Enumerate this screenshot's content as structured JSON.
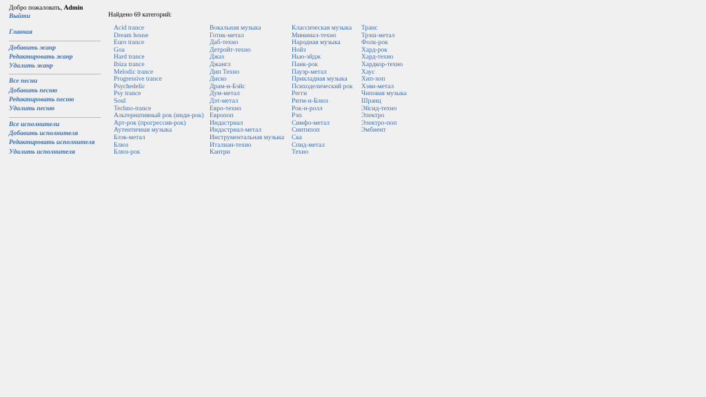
{
  "sidebar": {
    "welcome_text": "Добро пожаловать,",
    "username": "Admin",
    "logout": "Выйти",
    "home": "Главная",
    "genres": [
      "Добавить жанр",
      "Редактировать жанр",
      "Удалить жанр"
    ],
    "songs": [
      "Все песни",
      "Добавить песню",
      "Редактировать песню",
      "Удалить песню"
    ],
    "artists": [
      "Все исполнители",
      "Добавить исполнителя",
      "Редактировать исполнителя",
      "Удалить исполнителя"
    ]
  },
  "main": {
    "found_text": "Найдено 69 категорий:",
    "columns": [
      [
        "Acid trance",
        "Dream house",
        "Euro trance",
        "Goa",
        "Hard trance",
        "Ibiza trance",
        "Melodic trance",
        "Progressive trance",
        "Psychedelic",
        "Psy trance",
        "Soul",
        "Techno-trance",
        "Альтернативный рок (инди-рок)",
        "Арт-рок (прогрессив-рок)",
        "Аутентичная музыка",
        "Блэк-метал",
        "Блюз",
        "Блюз-рок"
      ],
      [
        "Вокальная музыка",
        "Готик-метал",
        "Даб-техно",
        "Детройт-техно",
        "Джаз",
        "Джангл",
        "Дип Техно",
        "Диско",
        "Драм-н-Бэйс",
        "Дум-метал",
        "Дэт-метал",
        "Евро-техно",
        "Европоп",
        "Индастриал",
        "Индастриал-метал",
        "Инструментальная музыка",
        "Италиан-техно",
        "Кантри"
      ],
      [
        "Классическая музыка",
        "Минимал-техно",
        "Народная музыка",
        "Нойз",
        "Нью-эйдж",
        "Панк-рок",
        "Пауэр-метал",
        "Прикладная музыка",
        "Психоделический рок",
        "Регги",
        "Ритм-н-Блюз",
        "Рок-н-ролл",
        "Рэп",
        "Симфо-метал",
        "Синтипоп",
        "Ска",
        "Спид-метал",
        "Техно"
      ],
      [
        "Транс",
        "Трэш-метал",
        "Фолк-рок",
        "Хард-рок",
        "Хард-техно",
        "Хардкор-техно",
        "Хаус",
        "Хип-хоп",
        "Хэви-метал",
        "Чиповая музыка",
        "Шранц",
        "Эйсид-техно",
        "Электро",
        "Электро-поп",
        "Эмбиент"
      ]
    ]
  }
}
